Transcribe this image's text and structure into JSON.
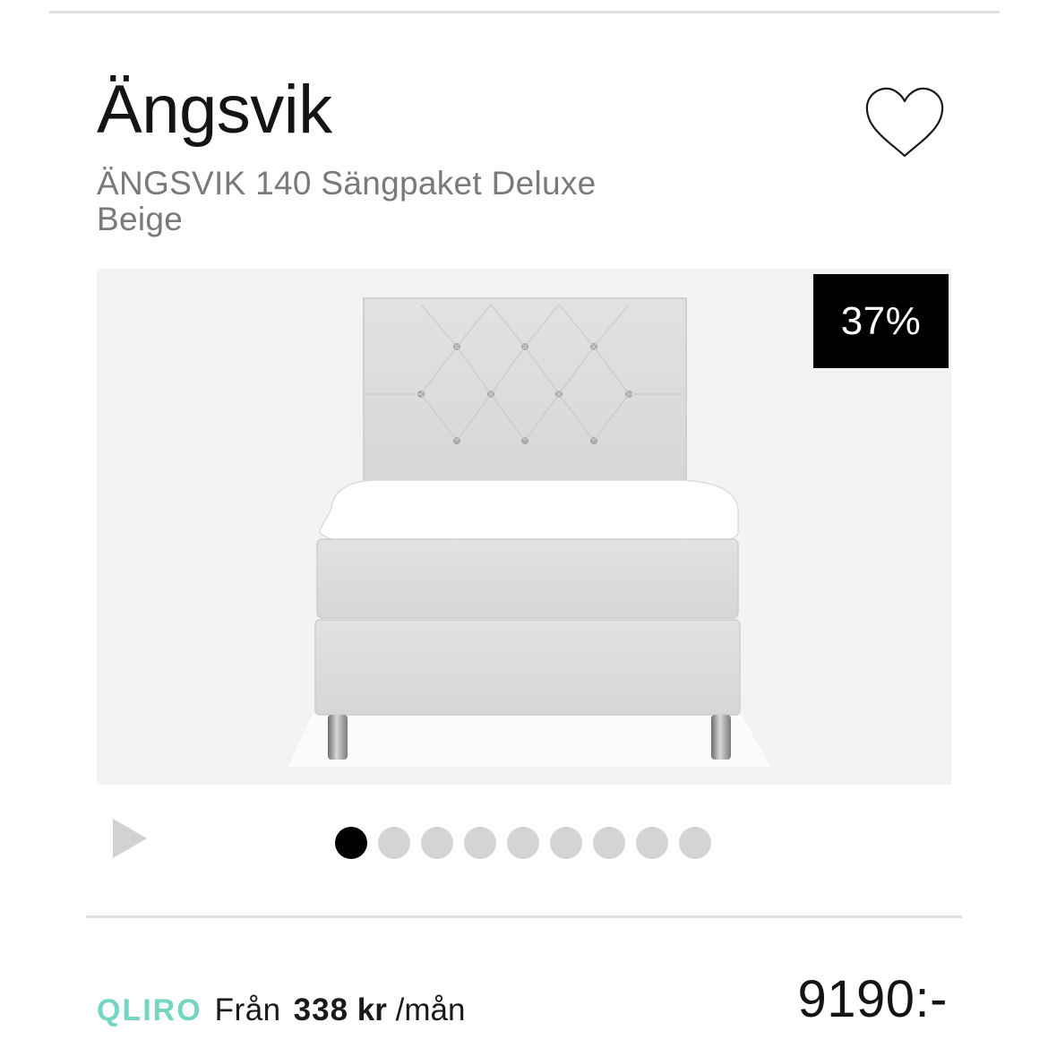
{
  "product": {
    "brand": "Ängsvik",
    "name": "ÄNGSVIK 140 Sängpaket Deluxe Beige",
    "discount_badge": "37%",
    "price": "9190:-"
  },
  "gallery": {
    "image_count": 9,
    "active_index": 0,
    "play_icon": "play-icon"
  },
  "favorite": {
    "icon": "heart-icon"
  },
  "financing": {
    "provider": "QLIRO",
    "prefix": "Från",
    "amount": "338",
    "currency": "kr",
    "period": "/mån"
  },
  "colors": {
    "qliro_accent": "#74d6c2",
    "badge_bg": "#000000",
    "dot_active": "#000000",
    "dot_inactive": "#d4d4d4"
  }
}
